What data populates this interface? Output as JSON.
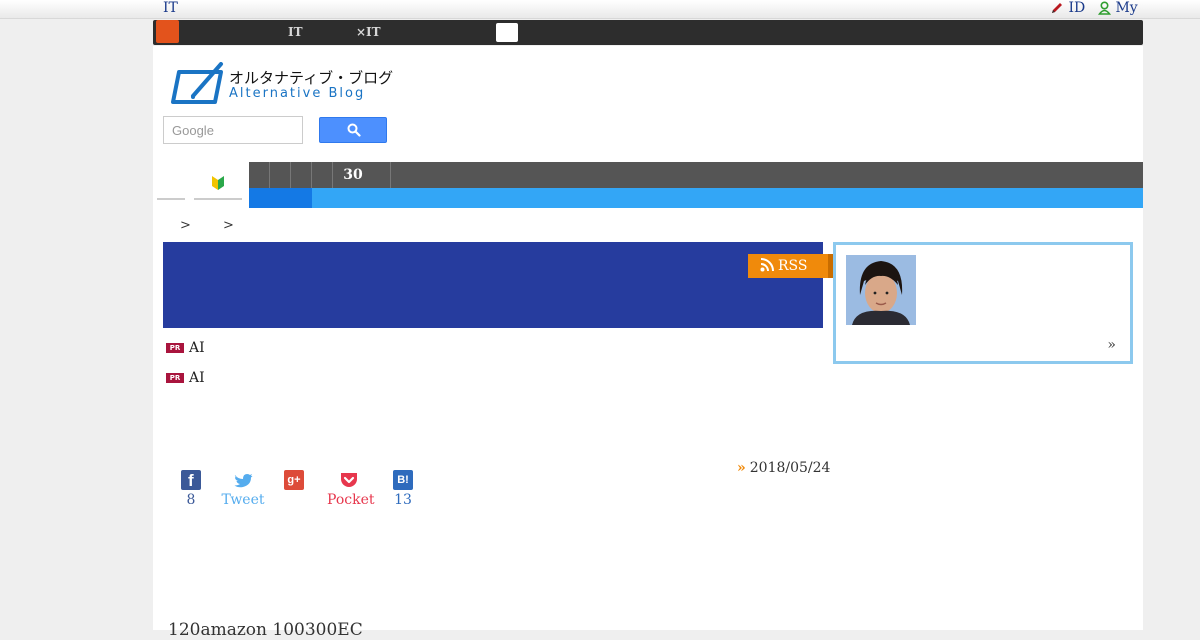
{
  "topbar": {
    "left_label": "IT",
    "id_label": "ID",
    "my_label": "My"
  },
  "global_nav": {
    "items": [
      "",
      "",
      "",
      "IT",
      "×IT",
      "",
      "",
      ""
    ]
  },
  "header": {
    "logo_jp": "オルタナティブ・ブログ",
    "logo_en": "Alternative Blog",
    "search_placeholder": "Google"
  },
  "category_bar": {
    "number": "30"
  },
  "breadcrumb": {
    "separator_1": ">",
    "separator_2": ">"
  },
  "rss_label": "RSS",
  "pr_items": [
    {
      "badge": "PR",
      "text": "AI"
    },
    {
      "badge": "PR",
      "text": "AI"
    }
  ],
  "post": {
    "date_marker": "»",
    "date": "2018/05/24",
    "teaser": "120amazon 100300EC"
  },
  "share": {
    "facebook_count": "8",
    "twitter_label": "Tweet",
    "google_label": "g+",
    "pocket_label": "Pocket",
    "hatena_label": "B!",
    "hatena_count": "13"
  },
  "profile": {
    "more_label": "»"
  },
  "colors": {
    "banner": "#263c9e",
    "rss": "#f08a0b",
    "tab_bar": "#33a6f6",
    "tab_active": "#1479e5",
    "profile_border": "#8cc9ee",
    "pr_badge": "#a9143d"
  }
}
